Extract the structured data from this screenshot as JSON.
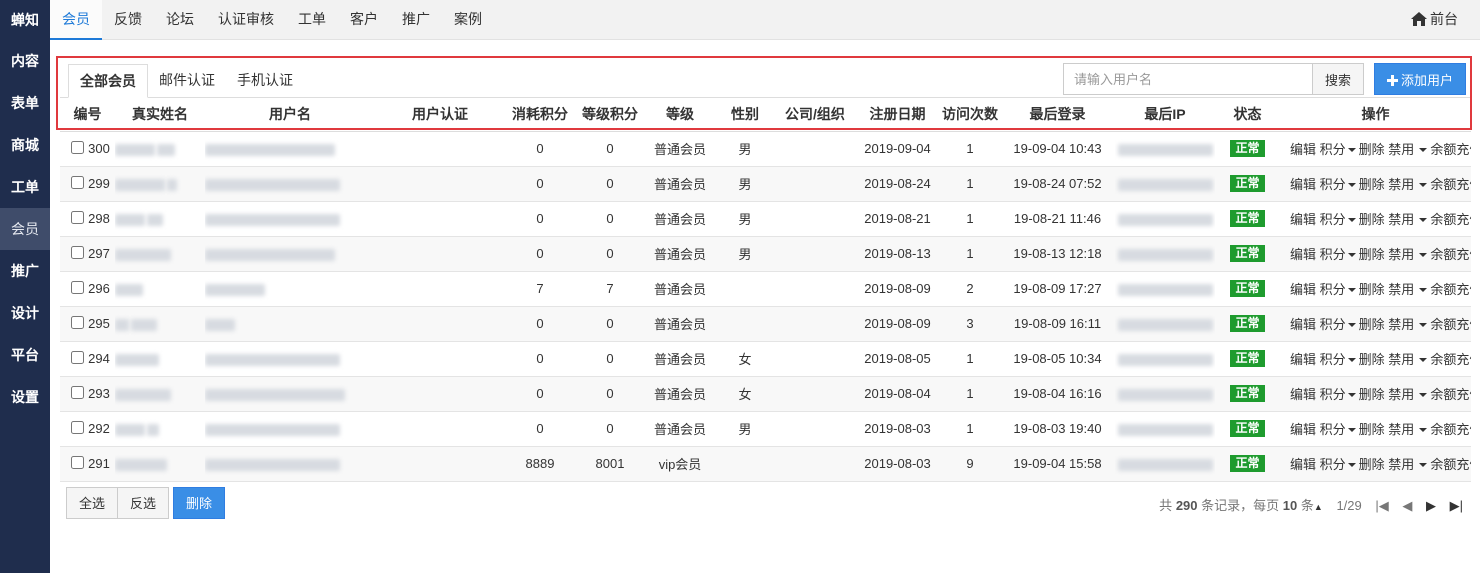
{
  "sidebar": {
    "brand": "蝉知",
    "items": [
      {
        "label": "内容"
      },
      {
        "label": "表单"
      },
      {
        "label": "商城"
      },
      {
        "label": "工单"
      },
      {
        "label": "会员",
        "active": true
      },
      {
        "label": "推广"
      },
      {
        "label": "设计"
      },
      {
        "label": "平台"
      },
      {
        "label": "设置"
      }
    ]
  },
  "topnav": {
    "tabs": [
      {
        "label": "会员",
        "active": true
      },
      {
        "label": "反馈"
      },
      {
        "label": "论坛"
      },
      {
        "label": "认证审核"
      },
      {
        "label": "工单"
      },
      {
        "label": "客户"
      },
      {
        "label": "推广"
      },
      {
        "label": "案例"
      }
    ],
    "frontend_label": "前台",
    "frontend_icon": "home-icon"
  },
  "filters": {
    "tabs": [
      {
        "label": "全部会员",
        "active": true
      },
      {
        "label": "邮件认证"
      },
      {
        "label": "手机认证"
      }
    ],
    "search_placeholder": "请输入用户名",
    "search_button": "搜索",
    "add_button": "添加用户",
    "add_icon": "plus-icon"
  },
  "table": {
    "columns": [
      "编号",
      "真实姓名",
      "用户名",
      "用户认证",
      "消耗积分",
      "等级积分",
      "等级",
      "性别",
      "公司/组织",
      "注册日期",
      "访问次数",
      "最后登录",
      "最后IP",
      "状态",
      "操作"
    ],
    "rows": [
      {
        "id": "300",
        "spent": "0",
        "level_points": "0",
        "level": "普通会员",
        "gender": "男",
        "reg_date": "2019-09-04",
        "visits": "1",
        "last_login": "19-09-04 10:43",
        "status": "正常"
      },
      {
        "id": "299",
        "spent": "0",
        "level_points": "0",
        "level": "普通会员",
        "gender": "男",
        "reg_date": "2019-08-24",
        "visits": "1",
        "last_login": "19-08-24 07:52",
        "status": "正常"
      },
      {
        "id": "298",
        "spent": "0",
        "level_points": "0",
        "level": "普通会员",
        "gender": "男",
        "reg_date": "2019-08-21",
        "visits": "1",
        "last_login": "19-08-21 11:46",
        "status": "正常"
      },
      {
        "id": "297",
        "spent": "0",
        "level_points": "0",
        "level": "普通会员",
        "gender": "男",
        "reg_date": "2019-08-13",
        "visits": "1",
        "last_login": "19-08-13 12:18",
        "status": "正常"
      },
      {
        "id": "296",
        "spent": "7",
        "level_points": "7",
        "level": "普通会员",
        "gender": "",
        "reg_date": "2019-08-09",
        "visits": "2",
        "last_login": "19-08-09 17:27",
        "status": "正常"
      },
      {
        "id": "295",
        "spent": "0",
        "level_points": "0",
        "level": "普通会员",
        "gender": "",
        "reg_date": "2019-08-09",
        "visits": "3",
        "last_login": "19-08-09 16:11",
        "status": "正常"
      },
      {
        "id": "294",
        "spent": "0",
        "level_points": "0",
        "level": "普通会员",
        "gender": "女",
        "reg_date": "2019-08-05",
        "visits": "1",
        "last_login": "19-08-05 10:34",
        "status": "正常"
      },
      {
        "id": "293",
        "spent": "0",
        "level_points": "0",
        "level": "普通会员",
        "gender": "女",
        "reg_date": "2019-08-04",
        "visits": "1",
        "last_login": "19-08-04 16:16",
        "status": "正常"
      },
      {
        "id": "292",
        "spent": "0",
        "level_points": "0",
        "level": "普通会员",
        "gender": "男",
        "reg_date": "2019-08-03",
        "visits": "1",
        "last_login": "19-08-03 19:40",
        "status": "正常"
      },
      {
        "id": "291",
        "spent": "8889",
        "level_points": "8001",
        "level": "vip会员",
        "gender": "",
        "reg_date": "2019-08-03",
        "visits": "9",
        "last_login": "19-09-04 15:58",
        "status": "正常"
      }
    ],
    "actions": {
      "edit": "编辑",
      "points": "积分",
      "delete": "删除",
      "ban": "禁用",
      "recharge": "余额充值"
    }
  },
  "footer": {
    "select_all": "全选",
    "invert": "反选",
    "delete": "删除",
    "total_prefix": "共",
    "total": "290",
    "total_suffix": "条记录，每页",
    "per_page": "10",
    "per_page_suffix": "条",
    "page_info": "1/29"
  },
  "colors": {
    "sidebar": "#1f2d4d",
    "accent": "#3a8ee6",
    "status_ok": "#1e9b2e",
    "highlight_border": "#e0393e"
  }
}
